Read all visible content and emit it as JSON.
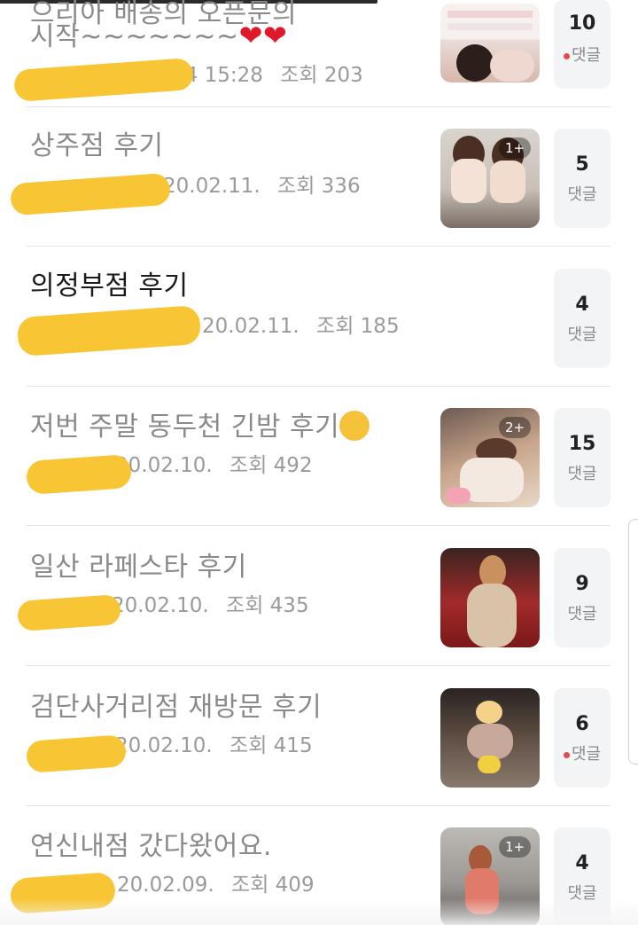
{
  "posts": [
    {
      "title": "시작~~~~~~~",
      "title_top_cut": "으리아 배송의 오픈문의",
      "date": "74 15:28",
      "views": "조회 203",
      "comments": "10",
      "comment_label": "댓글",
      "has_new_comment": true,
      "images_badge": ""
    },
    {
      "title": "상주점 후기",
      "date": "20.02.11.",
      "views": "조회 336",
      "comments": "5",
      "comment_label": "댓글",
      "has_new_comment": false,
      "images_badge": "1+"
    },
    {
      "title": "의정부점 후기",
      "date": "20.02.11.",
      "views": "조회 185",
      "comments": "4",
      "comment_label": "댓글",
      "has_new_comment": false,
      "images_badge": ""
    },
    {
      "title": "저번 주말 동두천 긴밤 후기",
      "date": "20.02.10.",
      "views": "조회 492",
      "comments": "15",
      "comment_label": "댓글",
      "has_new_comment": false,
      "images_badge": "2+"
    },
    {
      "title": "일산 라페스타 후기",
      "date": "20.02.10.",
      "views": "조회 435",
      "comments": "9",
      "comment_label": "댓글",
      "has_new_comment": false,
      "images_badge": ""
    },
    {
      "title": "검단사거리점 재방문 후기",
      "date": "20.02.10.",
      "views": "조회 415",
      "comments": "6",
      "comment_label": "댓글",
      "has_new_comment": true,
      "images_badge": ""
    },
    {
      "title": "연신내점 갔다왔어요.",
      "date": "20.02.09.",
      "views": "조회 409",
      "comments": "4",
      "comment_label": "댓글",
      "has_new_comment": false,
      "images_badge": "1+"
    }
  ],
  "colors": {
    "redaction": "#f8c534",
    "new_dot": "#e5484d",
    "comment_box_bg": "#f3f4f6"
  }
}
